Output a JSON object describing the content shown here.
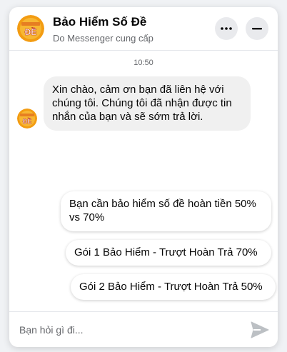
{
  "header": {
    "page_name": "Bảo Hiểm Số Đề",
    "subtitle": "Do Messenger cung cấp"
  },
  "conversation": {
    "timestamp": "10:50",
    "messages": [
      {
        "from": "page",
        "text": "Xin chào, cảm ơn bạn đã liên hệ với chúng tôi. Chúng tôi đã nhận được tin nhắn của bạn và sẽ sớm trả lời."
      }
    ],
    "quick_replies": [
      {
        "label": "Bạn cần bảo hiểm số đề hoàn tiền 50% vs 70%"
      },
      {
        "label": "Gói 1 Bảo Hiểm - Trượt Hoàn Trả 70%"
      },
      {
        "label": "Gói 2 Bảo Hiểm - Trượt Hoàn Trả 50%"
      }
    ]
  },
  "composer": {
    "placeholder": "Bạn hỏi gì đi..."
  },
  "icons": {
    "more": "more-horizontal-icon",
    "minimize": "minimize-icon",
    "send": "send-icon",
    "avatar": "page-logo-icon"
  },
  "colors": {
    "avatar_orange": "#f39c12",
    "send_gray": "#bcc0c4",
    "bubble_gray": "#f0f0f0"
  }
}
